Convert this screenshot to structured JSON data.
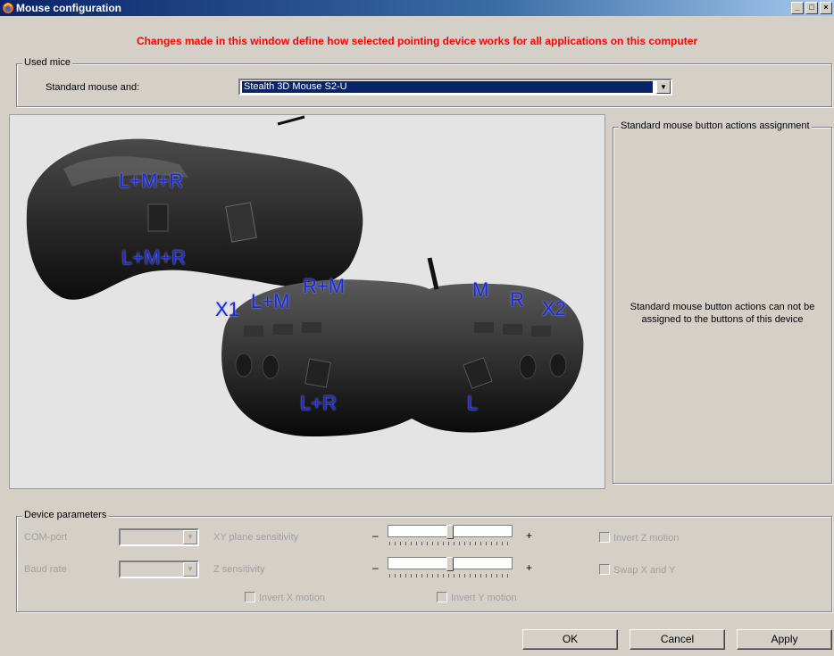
{
  "window": {
    "title": "Mouse configuration",
    "minimize_glyph": "_",
    "maximize_glyph": "□",
    "close_glyph": "×"
  },
  "notice": "Changes made in this window define how selected pointing device works for all applications on this computer",
  "used_mice": {
    "caption": "Used mice",
    "label": "Standard mouse and:",
    "selected": "Stealth 3D Mouse S2-U",
    "dropdown_glyph": "▼"
  },
  "image": {
    "labels": {
      "top_upper": "L+M+R",
      "top_lower": "L+M+R",
      "x1": "X1",
      "lm": "L+M",
      "rm": "R+M",
      "m": "M",
      "r": "R",
      "x2": "X2",
      "lr": "L+R",
      "l": "L"
    }
  },
  "assignment": {
    "caption": "Standard mouse button actions assignment",
    "message_line1": "Standard mouse button actions can not be",
    "message_line2": "assigned to the buttons of this device"
  },
  "device": {
    "caption": "Device parameters",
    "com_port_label": "COM-port",
    "baud_rate_label": "Baud rate",
    "xy_label": "XY plane sensitivity",
    "z_label": "Z sensitivity",
    "minus": "–",
    "plus": "+",
    "xy_level": 0.5,
    "z_level": 0.5,
    "invert_z": "Invert Z motion",
    "swap_xy": "Swap X and Y",
    "invert_x": "Invert X motion",
    "invert_y": "Invert Y motion",
    "dropdown_glyph": "▼"
  },
  "buttons": {
    "ok": "OK",
    "cancel": "Cancel",
    "apply": "Apply"
  },
  "colors": {
    "notice": "#ff0000",
    "label_blue": "#1a2bd6",
    "selection": "#0a246a"
  }
}
